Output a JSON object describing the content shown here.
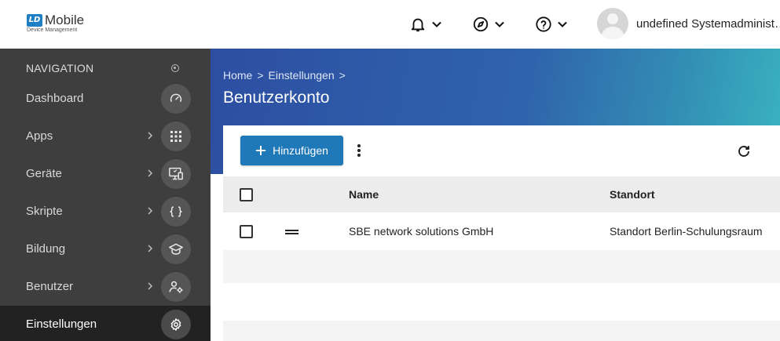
{
  "app": {
    "logo_badge": "LD",
    "logo_title": "Mobile",
    "logo_subtitle": "Device Management"
  },
  "topbar": {
    "icons": [
      "bell-icon",
      "compass-icon",
      "help-icon"
    ],
    "user_name": "undefined Systemadministrator"
  },
  "sidebar": {
    "header": "NAVIGATION",
    "items": [
      {
        "label": "Dashboard",
        "icon": "speedometer-icon",
        "has_arrow": false
      },
      {
        "label": "Apps",
        "icon": "grid-icon",
        "has_arrow": true
      },
      {
        "label": "Geräte",
        "icon": "device-icon",
        "has_arrow": true
      },
      {
        "label": "Skripte",
        "icon": "braces-icon",
        "has_arrow": true
      },
      {
        "label": "Bildung",
        "icon": "graduation-cap-icon",
        "has_arrow": true
      },
      {
        "label": "Benutzer",
        "icon": "user-settings-icon",
        "has_arrow": true
      },
      {
        "label": "Einstellungen",
        "icon": "gear-icon",
        "has_arrow": false,
        "active": true
      }
    ]
  },
  "breadcrumb": {
    "home": "Home",
    "sep": ">",
    "settings": "Einstellungen"
  },
  "page": {
    "title": "Benutzerkonto"
  },
  "toolbar": {
    "add_label": "Hinzufügen"
  },
  "table": {
    "columns": [
      "Name",
      "Standort"
    ],
    "rows": [
      {
        "name": "SBE network solutions GmbH",
        "standort": "Standort Berlin-Schulungsraum"
      }
    ]
  },
  "colors": {
    "accent": "#1f79b8",
    "sidebar_bg": "#3e3e3e",
    "sidebar_active": "#222222",
    "header_gradient_start": "#2d4ea2",
    "header_gradient_end": "#39b3c1"
  }
}
